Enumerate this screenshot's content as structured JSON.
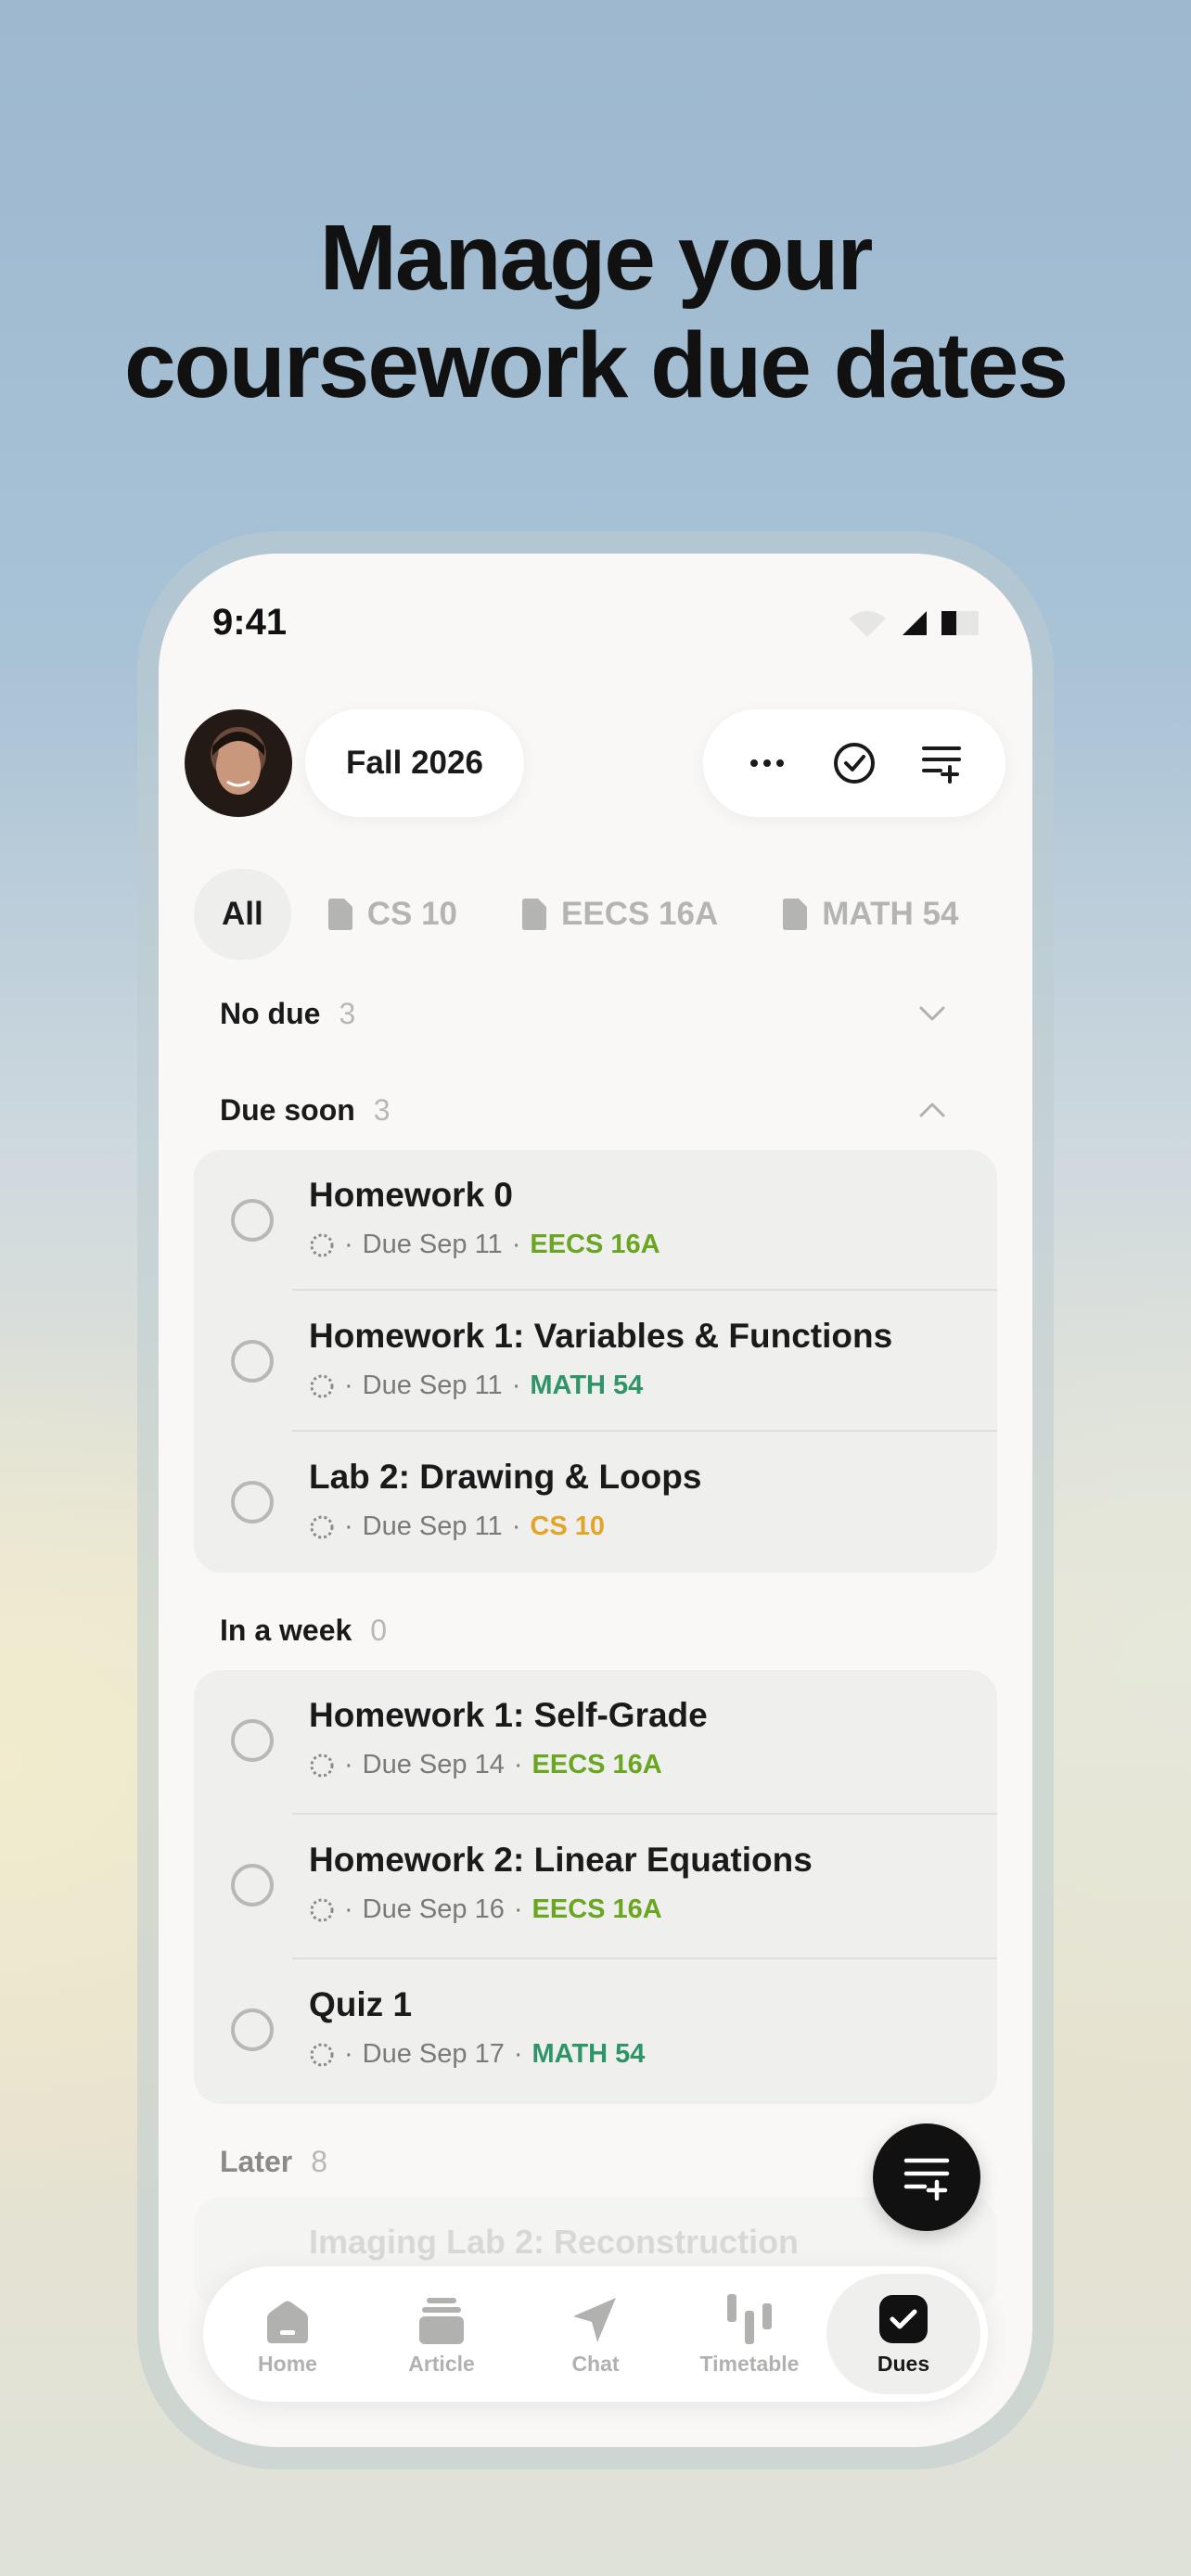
{
  "headline": {
    "line1": "Manage your",
    "line2": "coursework due dates"
  },
  "status_bar": {
    "time": "9:41"
  },
  "header": {
    "semester": "Fall 2026",
    "actions": [
      "more-icon",
      "check-circle-icon",
      "add-list-icon"
    ]
  },
  "filters": [
    {
      "label": "All",
      "active": true
    },
    {
      "label": "CS 10",
      "active": false
    },
    {
      "label": "EECS 16A",
      "active": false
    },
    {
      "label": "MATH 54",
      "active": false
    }
  ],
  "colors": {
    "EECS 16A": "#6aa621",
    "MATH 54": "#2f9466",
    "CS 10": "#e2a52a"
  },
  "sections": {
    "no_due": {
      "label": "No due",
      "count": "3"
    },
    "due_soon": {
      "label": "Due soon",
      "count": "3",
      "tasks": [
        {
          "title": "Homework 0",
          "due": "Due Sep 11",
          "course": "EECS 16A"
        },
        {
          "title": "Homework 1: Variables & Functions",
          "due": "Due Sep 11",
          "course": "MATH 54"
        },
        {
          "title": "Lab 2: Drawing & Loops",
          "due": "Due Sep 11",
          "course": "CS 10"
        }
      ]
    },
    "in_a_week": {
      "label": "In a week",
      "count": "0",
      "tasks": [
        {
          "title": "Homework 1: Self-Grade",
          "due": "Due Sep 14",
          "course": "EECS 16A"
        },
        {
          "title": "Homework 2: Linear Equations",
          "due": "Due Sep 16",
          "course": "EECS 16A"
        },
        {
          "title": "Quiz 1",
          "due": "Due Sep 17",
          "course": "MATH 54"
        }
      ]
    },
    "later": {
      "label": "Later",
      "count": "8",
      "first_task": "Imaging Lab 2: Reconstruction"
    }
  },
  "separator": "·",
  "tabbar": [
    {
      "label": "Home",
      "icon": "home-icon",
      "active": false
    },
    {
      "label": "Article",
      "icon": "article-icon",
      "active": false
    },
    {
      "label": "Chat",
      "icon": "chat-icon",
      "active": false
    },
    {
      "label": "Timetable",
      "icon": "timetable-icon",
      "active": false
    },
    {
      "label": "Dues",
      "icon": "dues-icon",
      "active": true
    }
  ]
}
